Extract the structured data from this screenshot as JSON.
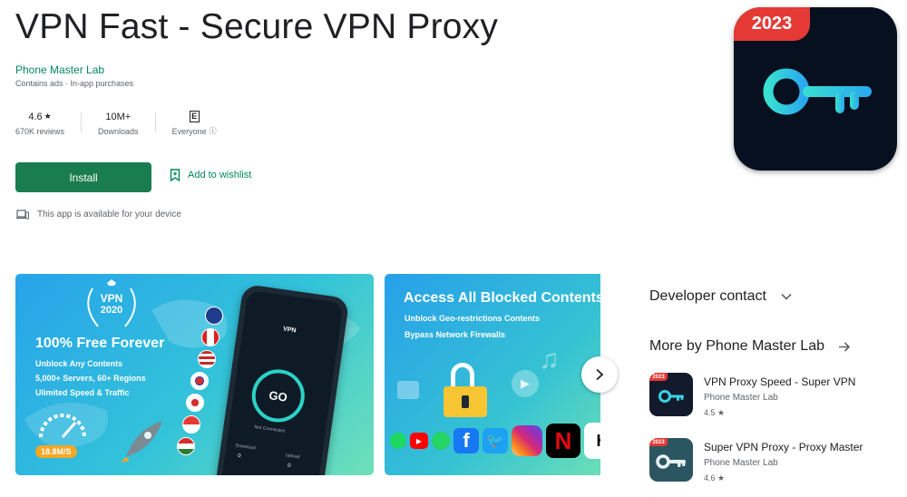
{
  "app": {
    "title": "VPN Fast - Secure VPN Proxy",
    "developer": "Phone Master Lab",
    "badges": "Contains ads · In-app purchases",
    "icon_badge": "2023"
  },
  "stats": {
    "rating": "4.6",
    "rating_star": "★",
    "reviews": "670K reviews",
    "downloads": "10M+",
    "downloads_label": "Downloads",
    "content_rating": "E",
    "content_label": "Everyone"
  },
  "actions": {
    "install": "Install",
    "wishlist": "Add to wishlist",
    "device_note": "This app is available for your device"
  },
  "screenshot1": {
    "badge_title": "VPN",
    "badge_year": "2020",
    "headline": "100% Free Forever",
    "lines": [
      "Unblock Any Contents",
      "5,000+ Servers,  60+ Regions",
      "Ulimited Speed & Traffic"
    ],
    "speed": "18.8M/S",
    "phone_header": "VPN",
    "go": "GO",
    "status": "Not Connected",
    "download": "Download",
    "upload": "Upload",
    "zero": "0"
  },
  "screenshot2": {
    "headline": "Access All Blocked Contents",
    "line1": "Unblock Geo-restrictions Contents",
    "line2": "Bypass Network Firewalls"
  },
  "sidebar": {
    "developer_contact": "Developer contact",
    "more_by": "More by Phone Master Lab",
    "apps": [
      {
        "name": "VPN Proxy Speed - Super VPN",
        "developer": "Phone Master Lab",
        "rating": "4.5 ★",
        "badge": "2023"
      },
      {
        "name": "Super VPN Proxy - Proxy Master",
        "developer": "Phone Master Lab",
        "rating": "4.6 ★",
        "badge": "2023"
      }
    ]
  },
  "colors": {
    "accent": "#01875f",
    "install_bg": "#1a7d4f",
    "icon_bg": "#07101e",
    "badge_red": "#e53935"
  }
}
